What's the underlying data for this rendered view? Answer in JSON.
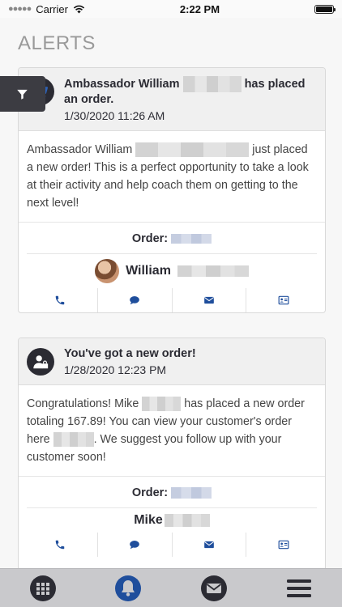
{
  "status_bar": {
    "carrier": "Carrier",
    "time": "2:22 PM",
    "battery_level": 1.0
  },
  "page": {
    "title": "ALERTS"
  },
  "alerts": [
    {
      "icon": "cart-icon",
      "title_prefix": "Ambassador William",
      "title_suffix": "has placed an order.",
      "date": "1/30/2020 11:26 AM",
      "body_prefix": "Ambassador William",
      "body_suffix": "just placed a new order! This is a perfect opportunity to take a look at their activity and help coach them on getting to the next level!",
      "order_label": "Order:",
      "person_name": "William",
      "actions": [
        "phone-icon",
        "chat-icon",
        "mail-icon",
        "contact-card-icon"
      ]
    },
    {
      "icon": "customer-icon",
      "title": "You've got a new order!",
      "date": "1/28/2020 12:23 PM",
      "body_p1": "Congratulations! Mike",
      "body_p2": "has placed a new order totaling 167.89! You can view your customer's order here",
      "body_p3": ". We suggest you follow up with your customer soon!",
      "order_label": "Order:",
      "person_name": "Mike",
      "actions": [
        "phone-icon",
        "chat-icon",
        "mail-icon",
        "contact-card-icon"
      ]
    }
  ],
  "tab_bar": {
    "items": [
      "grid-icon",
      "bell-icon",
      "mail-icon",
      "menu-icon"
    ],
    "active": "bell-icon"
  },
  "colors": {
    "accent": "#1f4e9c",
    "header_bg": "#f0f0f0",
    "tab_bar_bg": "#c9c9cc",
    "tab_icon": "#2b2b33"
  }
}
